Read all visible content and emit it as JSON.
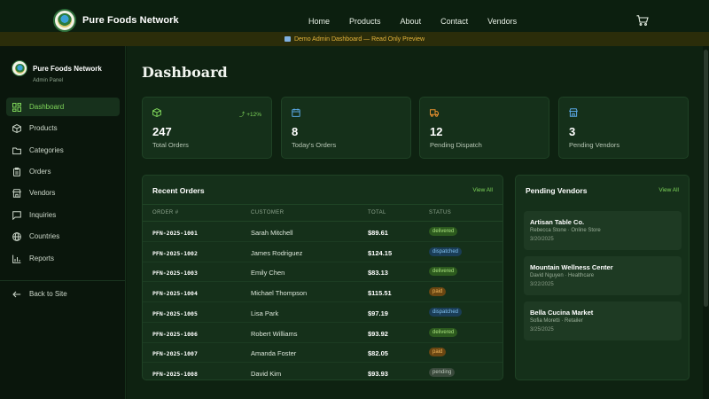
{
  "nav": {
    "brand": "Pure Foods Network",
    "links": [
      "Home",
      "Products",
      "About",
      "Contact",
      "Vendors"
    ]
  },
  "banner": {
    "text": "Demo Admin Dashboard — Read Only Preview"
  },
  "sidebar": {
    "brand": "Pure Foods Network",
    "subtitle": "Admin Panel",
    "items": [
      {
        "label": "Dashboard",
        "icon": "grid-icon"
      },
      {
        "label": "Products",
        "icon": "box-icon"
      },
      {
        "label": "Categories",
        "icon": "folder-icon"
      },
      {
        "label": "Orders",
        "icon": "clipboard-icon"
      },
      {
        "label": "Vendors",
        "icon": "store-icon"
      },
      {
        "label": "Inquiries",
        "icon": "message-icon"
      },
      {
        "label": "Countries",
        "icon": "globe-icon"
      },
      {
        "label": "Reports",
        "icon": "bar-chart-icon"
      }
    ],
    "back": "Back to Site"
  },
  "page": {
    "title": "Dashboard"
  },
  "stats": [
    {
      "value": "247",
      "label": "Total Orders",
      "trend": "+12%",
      "color": "#7fd65a"
    },
    {
      "value": "8",
      "label": "Today's Orders",
      "color": "#5aa8e6"
    },
    {
      "value": "12",
      "label": "Pending Dispatch",
      "color": "#e8902e"
    },
    {
      "value": "3",
      "label": "Pending Vendors",
      "color": "#5aa8e6"
    }
  ],
  "orders": {
    "title": "Recent Orders",
    "view_all": "View All",
    "headers": [
      "ORDER #",
      "CUSTOMER",
      "TOTAL",
      "STATUS"
    ],
    "rows": [
      {
        "id": "PFN-2025-1001",
        "customer": "Sarah Mitchell",
        "total": "$89.61",
        "status": "delivered"
      },
      {
        "id": "PFN-2025-1002",
        "customer": "James Rodriguez",
        "total": "$124.15",
        "status": "dispatched"
      },
      {
        "id": "PFN-2025-1003",
        "customer": "Emily Chen",
        "total": "$83.13",
        "status": "delivered"
      },
      {
        "id": "PFN-2025-1004",
        "customer": "Michael Thompson",
        "total": "$115.51",
        "status": "paid"
      },
      {
        "id": "PFN-2025-1005",
        "customer": "Lisa Park",
        "total": "$97.19",
        "status": "dispatched"
      },
      {
        "id": "PFN-2025-1006",
        "customer": "Robert Williams",
        "total": "$93.92",
        "status": "delivered"
      },
      {
        "id": "PFN-2025-1007",
        "customer": "Amanda Foster",
        "total": "$82.05",
        "status": "paid"
      },
      {
        "id": "PFN-2025-1008",
        "customer": "David Kim",
        "total": "$93.93",
        "status": "pending"
      }
    ]
  },
  "vendors": {
    "title": "Pending Vendors",
    "view_all": "View All",
    "items": [
      {
        "name": "Artisan Table Co.",
        "detail": "Rebecca Stone · Online Store",
        "date": "3/20/2025"
      },
      {
        "name": "Mountain Wellness Center",
        "detail": "David Nguyen · Healthcare",
        "date": "3/22/2025"
      },
      {
        "name": "Bella Cucina Market",
        "detail": "Sofia Moretti · Retailer",
        "date": "3/25/2025"
      }
    ]
  }
}
